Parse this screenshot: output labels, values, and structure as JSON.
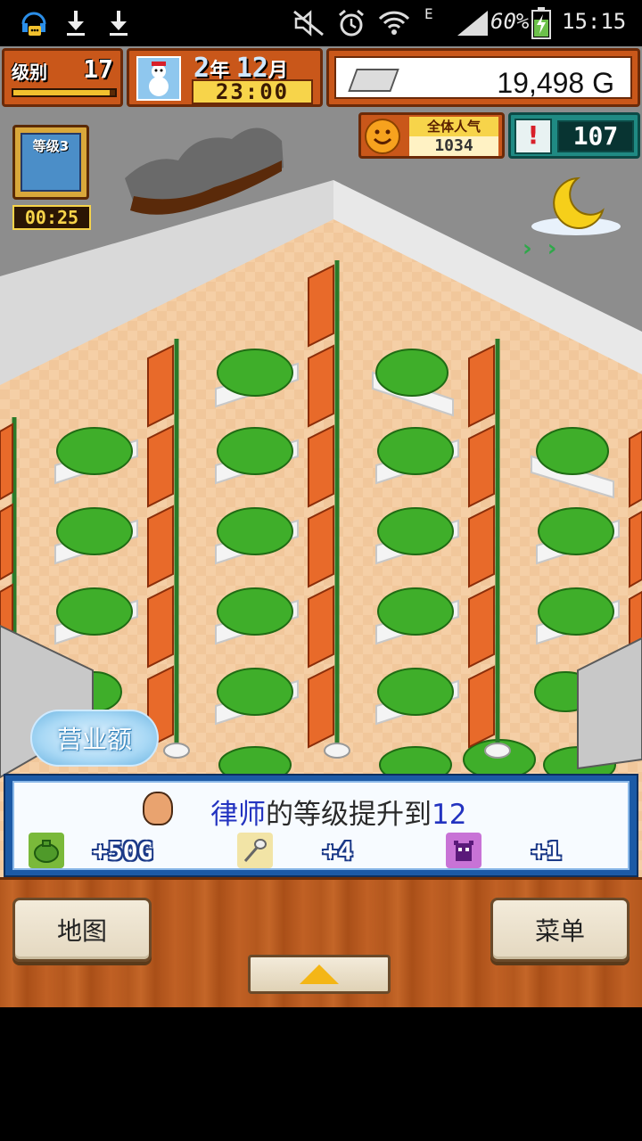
{
  "status_bar": {
    "icons": [
      "headset-chat-icon",
      "download-icon",
      "download-icon",
      "mute-icon",
      "alarm-icon",
      "wifi-icon",
      "signal-icon",
      "battery-icon"
    ],
    "network_type": "E",
    "battery_percent": "60%",
    "time": "15:15"
  },
  "hud": {
    "level_label": "级别",
    "level_value": "17",
    "level_progress": 0.95,
    "date_year": "2",
    "date_year_unit": "年",
    "date_month": "12",
    "date_month_unit": "月",
    "clock": "23:00",
    "money": "19,498 G",
    "popularity_label": "全体人气",
    "popularity_value": "1034",
    "research_value": "107",
    "speed_label": "等级3",
    "speed_timer": "00:25"
  },
  "scene": {
    "sales_button": "营业额"
  },
  "notification": {
    "job": "律师",
    "message_mid": "的等级提升到",
    "level": "12",
    "rewards": [
      {
        "icon": "money-bag-icon",
        "value": "+50G",
        "color": "#7ab93a"
      },
      {
        "icon": "spoon-icon",
        "value": "+4",
        "color": "#f2e4a6"
      },
      {
        "icon": "monster-icon",
        "value": "+1",
        "color": "#c873d6"
      }
    ]
  },
  "bottom_bar": {
    "map_label": "地图",
    "menu_label": "菜单",
    "expand_icon": "up-arrow-icon"
  },
  "colors": {
    "floor": "#f1c79b",
    "wall": "#e0e0e0",
    "hud_orange": "#c9571a",
    "notify_blue": "#1c5aa6",
    "highlight_blue": "#2333c0"
  }
}
